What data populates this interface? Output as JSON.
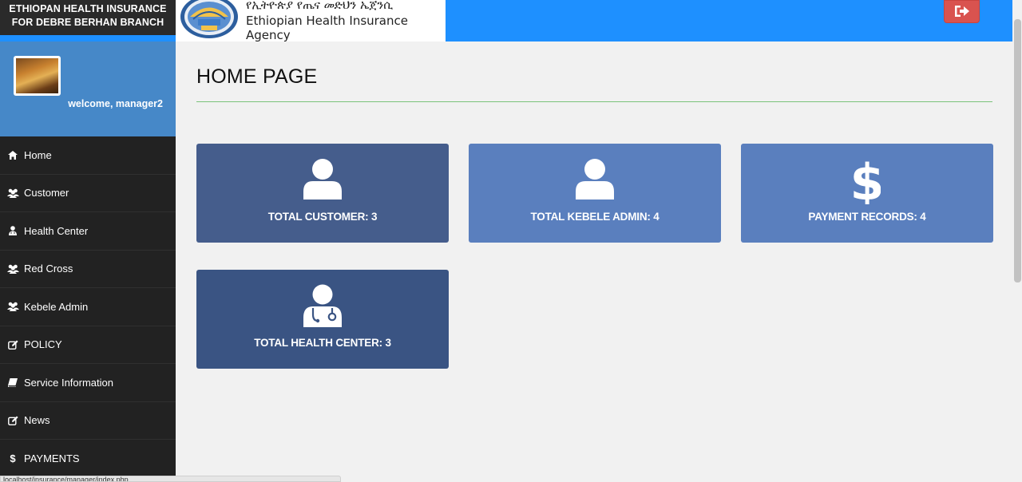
{
  "brand": {
    "line1": "ETHIOPAN HEALTH INSURANCE",
    "line2": "FOR DEBRE BERHAN BRANCH"
  },
  "header": {
    "logo_amharic": "የኢትዮጵያ የጤና መድህን ኤጀንሲ",
    "logo_english": "Ethiopian Health Insurance Agency",
    "logout_icon": "sign-out-icon",
    "accent": "#1e90ff"
  },
  "profile": {
    "welcome": "welcome, manager2"
  },
  "sidebar": {
    "items": [
      {
        "label": "Home",
        "icon": "home-icon"
      },
      {
        "label": "Customer",
        "icon": "users-icon"
      },
      {
        "label": "Health Center",
        "icon": "user-md-icon"
      },
      {
        "label": "Red Cross",
        "icon": "users-icon"
      },
      {
        "label": "Kebele Admin",
        "icon": "users-icon"
      },
      {
        "label": "POLICY",
        "icon": "edit-icon"
      },
      {
        "label": "Service Information",
        "icon": "book-icon"
      },
      {
        "label": "News",
        "icon": "edit-icon"
      },
      {
        "label": "PAYMENTS",
        "icon": "dollar-icon"
      }
    ]
  },
  "main": {
    "title": "HOME PAGE",
    "cards": [
      {
        "label": "TOTAL CUSTOMER: 3",
        "icon": "user-icon",
        "color": "#455d8c"
      },
      {
        "label": "TOTAL KEBELE ADMIN: 4",
        "icon": "user-icon",
        "color": "#5a7fbe"
      },
      {
        "label": "PAYMENT RECORDS: 4",
        "icon": "dollar-icon",
        "color": "#5a7fbe"
      },
      {
        "label": "TOTAL HEALTH CENTER: 3",
        "icon": "user-md-icon",
        "color": "#3a5483"
      }
    ]
  },
  "status": {
    "url": "localhost/insurance/manager/index.php"
  }
}
